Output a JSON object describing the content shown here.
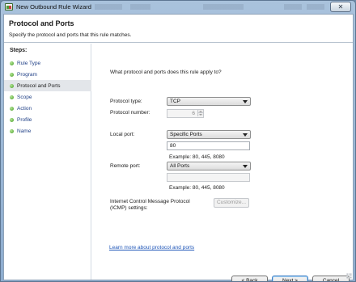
{
  "window": {
    "title": "New Outbound Rule Wizard",
    "close_glyph": "✕"
  },
  "header": {
    "title": "Protocol and Ports",
    "subtitle": "Specify the protocol and ports that this rule matches."
  },
  "sidebar": {
    "steps_label": "Steps:",
    "items": [
      {
        "label": "Rule Type",
        "active": false
      },
      {
        "label": "Program",
        "active": false
      },
      {
        "label": "Protocol and Ports",
        "active": true
      },
      {
        "label": "Scope",
        "active": false
      },
      {
        "label": "Action",
        "active": false
      },
      {
        "label": "Profile",
        "active": false
      },
      {
        "label": "Name",
        "active": false
      }
    ]
  },
  "main": {
    "question": "What protocol and ports does this rule apply to?",
    "protocol_type": {
      "label": "Protocol type:",
      "value": "TCP"
    },
    "protocol_number": {
      "label": "Protocol number:",
      "value": "6"
    },
    "local_port": {
      "label": "Local port:",
      "selected": "Specific Ports",
      "value": "80",
      "example": "Example: 80, 445, 8080"
    },
    "remote_port": {
      "label": "Remote port:",
      "selected": "All Ports",
      "value": "",
      "example": "Example: 80, 445, 8080"
    },
    "icmp": {
      "label_line1": "Internet Control Message Protocol",
      "label_line2": "(ICMP) settings:",
      "button": "Customize..."
    },
    "learn_more": "Learn more about protocol and ports"
  },
  "footer": {
    "back": "< Back",
    "next": "Next >",
    "cancel": "Cancel"
  }
}
